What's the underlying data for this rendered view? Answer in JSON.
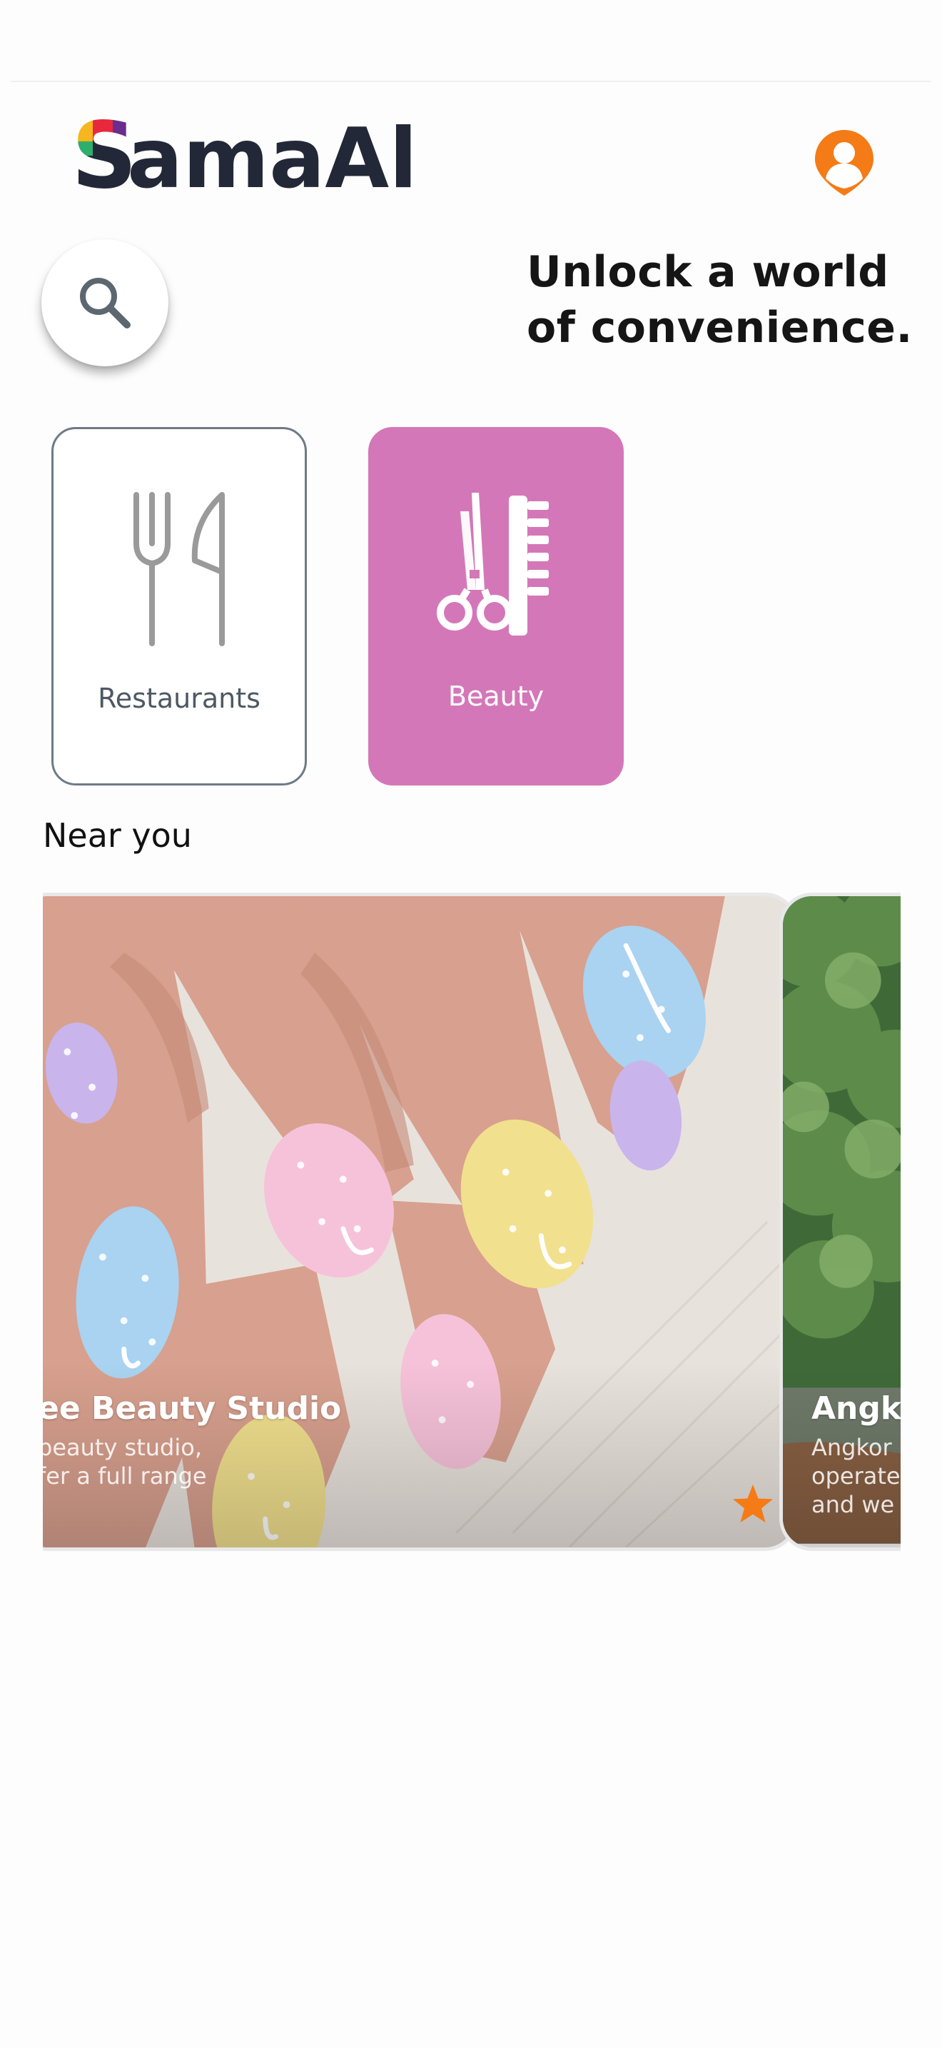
{
  "header": {
    "app_name": "SamaAll",
    "logo_icon": "samaall-logo",
    "profile_icon": "user-location-pin-icon"
  },
  "hero": {
    "search_icon": "search-icon",
    "tagline": "Unlock a world\nof convenience."
  },
  "categories": [
    {
      "label": "Restaurants",
      "icon": "fork-knife-icon",
      "selected": false
    },
    {
      "label": "Beauty",
      "icon": "scissors-comb-icon",
      "selected": true
    }
  ],
  "near_you": {
    "title": "Near you",
    "venues": [
      {
        "name": "ee Beauty Studio",
        "description": "beauty studio,\nfer a full range",
        "image": "nail-art-photo",
        "favorite": true
      },
      {
        "name": "Angk",
        "description": "Angkor\noperate\nand we",
        "image": "garden-trees-photo"
      }
    ]
  },
  "colors": {
    "accent_orange": "#f47b16",
    "beauty_pink": "#d477b8",
    "text_dark": "#151515",
    "logo_navy": "#232838"
  }
}
